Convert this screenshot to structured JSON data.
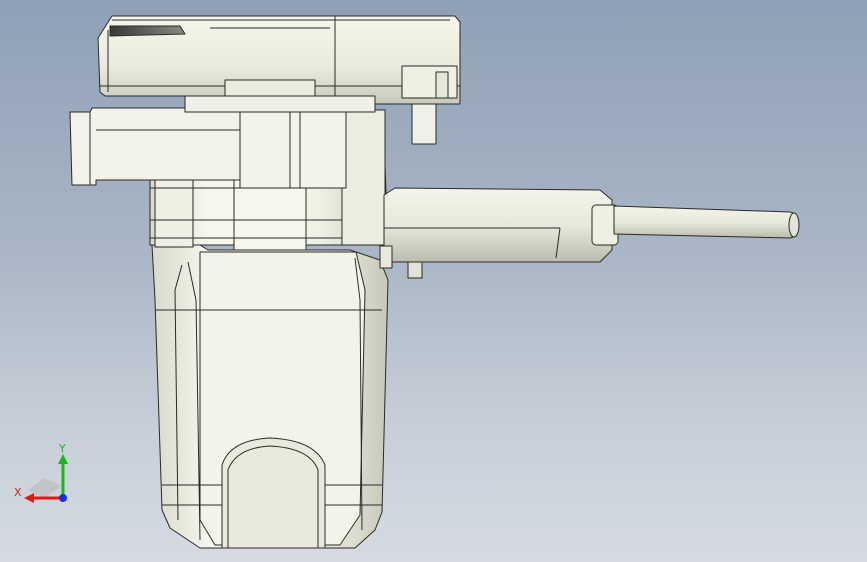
{
  "viewport": {
    "background_top": "#8fa0b6",
    "background_bottom": "#d6dbe2"
  },
  "model": {
    "fill": "#f4f4ea",
    "shade": "#cfcfc2",
    "edge": "#2a2a2a"
  },
  "triad": {
    "x_label": "X",
    "y_label": "Y",
    "x_color": "#e01818",
    "y_color": "#18b818",
    "z_color": "#1830e0"
  }
}
